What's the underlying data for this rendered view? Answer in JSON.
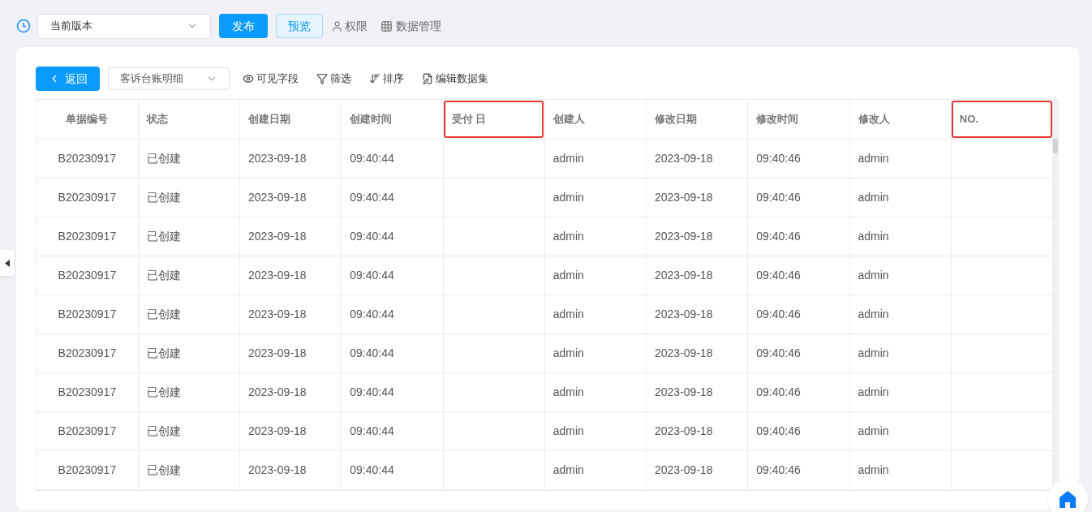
{
  "toolbar": {
    "version_select": {
      "value": "当前版本"
    },
    "publish_button": "发布",
    "preview_button": "预览",
    "permission_link": "权限",
    "data_link": "数据管理"
  },
  "card": {
    "back_button": "返回",
    "dataset_select": {
      "value": "客诉台账明细"
    },
    "actions": [
      {
        "kind": "eye",
        "label": "可见字段"
      },
      {
        "kind": "filter",
        "label": "筛选"
      },
      {
        "kind": "sort",
        "label": "排序"
      },
      {
        "kind": "edit",
        "label": "编辑数据集"
      }
    ]
  },
  "table": {
    "columns": [
      {
        "label": "单据编号",
        "highlighted": false
      },
      {
        "label": "状态",
        "highlighted": false
      },
      {
        "label": "创建日期",
        "highlighted": false
      },
      {
        "label": "创建时间",
        "highlighted": false
      },
      {
        "label": "受付 日",
        "highlighted": true
      },
      {
        "label": "创建人",
        "highlighted": false
      },
      {
        "label": "修改日期",
        "highlighted": false
      },
      {
        "label": "修改时间",
        "highlighted": false
      },
      {
        "label": "修改人",
        "highlighted": false
      },
      {
        "label": "NO.",
        "highlighted": true
      }
    ],
    "rows": [
      [
        "B20230917",
        "已创建",
        "2023-09-18",
        "09:40:44",
        "",
        "admin",
        "2023-09-18",
        "09:40:46",
        "admin",
        ""
      ],
      [
        "B20230917",
        "已创建",
        "2023-09-18",
        "09:40:44",
        "",
        "admin",
        "2023-09-18",
        "09:40:46",
        "admin",
        ""
      ],
      [
        "B20230917",
        "已创建",
        "2023-09-18",
        "09:40:44",
        "",
        "admin",
        "2023-09-18",
        "09:40:46",
        "admin",
        ""
      ],
      [
        "B20230917",
        "已创建",
        "2023-09-18",
        "09:40:44",
        "",
        "admin",
        "2023-09-18",
        "09:40:46",
        "admin",
        ""
      ],
      [
        "B20230917",
        "已创建",
        "2023-09-18",
        "09:40:44",
        "",
        "admin",
        "2023-09-18",
        "09:40:46",
        "admin",
        ""
      ],
      [
        "B20230917",
        "已创建",
        "2023-09-18",
        "09:40:44",
        "",
        "admin",
        "2023-09-18",
        "09:40:46",
        "admin",
        ""
      ],
      [
        "B20230917",
        "已创建",
        "2023-09-18",
        "09:40:44",
        "",
        "admin",
        "2023-09-18",
        "09:40:46",
        "admin",
        ""
      ],
      [
        "B20230917",
        "已创建",
        "2023-09-18",
        "09:40:44",
        "",
        "admin",
        "2023-09-18",
        "09:40:46",
        "admin",
        ""
      ],
      [
        "B20230917",
        "已创建",
        "2023-09-18",
        "09:40:44",
        "",
        "admin",
        "2023-09-18",
        "09:40:46",
        "admin",
        ""
      ]
    ]
  }
}
